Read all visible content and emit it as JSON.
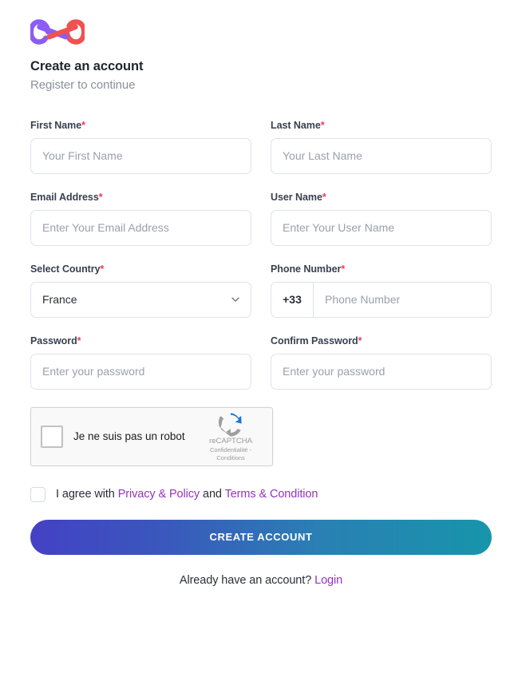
{
  "brand": {
    "logo_icon": "infinity-logo-icon",
    "logo_colors": {
      "left": "#8b5cf6",
      "right": "#f05151"
    }
  },
  "header": {
    "title": "Create an account",
    "subtitle": "Register to continue"
  },
  "form": {
    "required_mark": "*",
    "fields": {
      "first_name": {
        "label": "First Name",
        "placeholder": "Your First Name",
        "value": ""
      },
      "last_name": {
        "label": "Last Name",
        "placeholder": "Your Last Name",
        "value": ""
      },
      "email": {
        "label": "Email Address",
        "placeholder": "Enter Your Email Address",
        "value": ""
      },
      "user_name": {
        "label": "User Name",
        "placeholder": "Enter Your User Name",
        "value": ""
      },
      "country": {
        "label": "Select Country",
        "value": "France",
        "icon": "chevron-down-icon"
      },
      "phone": {
        "label": "Phone Number",
        "dial_code": "+33",
        "placeholder": "Phone Number",
        "value": ""
      },
      "password": {
        "label": "Password",
        "placeholder": "Enter your password",
        "value": ""
      },
      "confirm_password": {
        "label": "Confirm Password",
        "placeholder": "Enter your password",
        "value": ""
      }
    }
  },
  "recaptcha": {
    "label": "Je ne suis pas un robot",
    "brand": "reCAPTCHA",
    "terms": "Confidentialité - Conditions",
    "checked": false,
    "logo_icon": "recaptcha-logo-icon"
  },
  "agreement": {
    "checked": false,
    "text_before": "I agree with",
    "link_privacy": "Privacy & Policy",
    "text_middle": "and",
    "link_terms": "Terms & Condition"
  },
  "submit": {
    "label": "CREATE ACCOUNT"
  },
  "footer": {
    "text": "Already have an account?",
    "link": "Login"
  },
  "colors": {
    "accent_link": "#9333c4",
    "required": "#f2385a",
    "button_gradient_start": "#4441c4",
    "button_gradient_end": "#1795ab",
    "border": "#dfe3ec"
  }
}
